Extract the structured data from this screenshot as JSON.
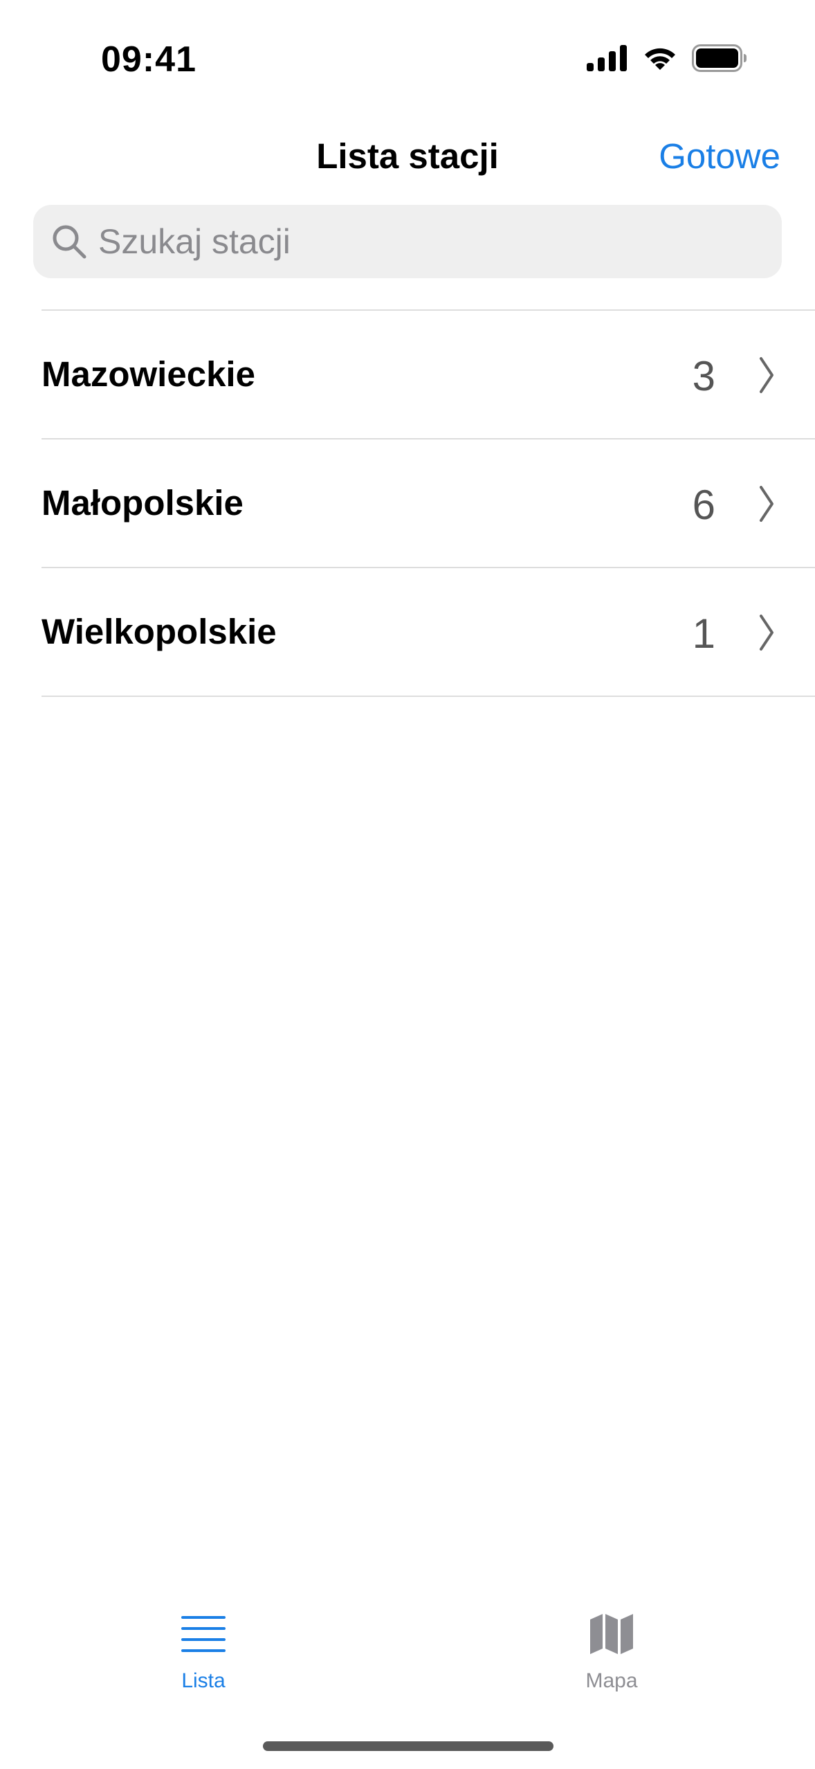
{
  "status_bar": {
    "time": "09:41",
    "icons": [
      "cellular-signal-icon",
      "wifi-icon",
      "battery-icon"
    ]
  },
  "nav": {
    "title": "Lista stacji",
    "done_label": "Gotowe"
  },
  "search": {
    "placeholder": "Szukaj stacji",
    "value": "",
    "icon": "search-icon"
  },
  "regions": [
    {
      "name": "Mazowieckie",
      "count": "3"
    },
    {
      "name": "Małopolskie",
      "count": "6"
    },
    {
      "name": "Wielkopolskie",
      "count": "1"
    }
  ],
  "tab_bar": {
    "tabs": [
      {
        "label": "Lista",
        "icon": "list-icon",
        "selected": true
      },
      {
        "label": "Mapa",
        "icon": "map-icon",
        "selected": false
      }
    ]
  },
  "colors": {
    "accent": "#1a7fe6",
    "inactive": "#8e8e93",
    "count_text": "#555555",
    "search_background": "#efefef",
    "divider": "#dddddd"
  }
}
